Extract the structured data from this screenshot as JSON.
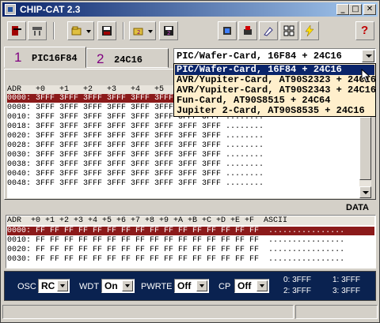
{
  "window": {
    "title": "CHIP-CAT 2.3",
    "minimize": "_",
    "maximize": "□",
    "close": "✕"
  },
  "toolbar": {
    "buttons": [
      "exit-icon",
      "settings-icon",
      "open-icon",
      "save-icon",
      "open2-icon",
      "save2-icon",
      "read-icon",
      "write-icon",
      "erase-icon",
      "verify-icon",
      "auto-icon",
      "help-icon"
    ],
    "help_label": "?"
  },
  "tabs": [
    {
      "num": "1",
      "label": "PIC16F84"
    },
    {
      "num": "2",
      "label": "24C16"
    }
  ],
  "card_select": {
    "value": "PIC/Wafer-Card, 16F84 + 24C16",
    "options": [
      "PIC/Wafer-Card, 16F84 + 24C16",
      "AVR/Yupiter-Card, AT90S2323 + 24C16",
      "AVR/Yupiter-Card, AT90S2343 + 24C16",
      "Fun-Card, AT90S8515 + 24C64",
      "Jupiter 2-Card, AT90S8535 + 24C16"
    ]
  },
  "program_memory": {
    "header": "ADR   +0   +1   +2   +3   +4   +5   +6   +7  ASCII",
    "rows": [
      "0000: 3FFF 3FFF 3FFF 3FFF 3FFF 3FFF 3FFF 3FFF ........",
      "0008: 3FFF 3FFF 3FFF 3FFF 3FFF 3FFF 3FFF 3FFF ........",
      "0010: 3FFF 3FFF 3FFF 3FFF 3FFF 3FFF 3FFF 3FFF ........",
      "0018: 3FFF 3FFF 3FFF 3FFF 3FFF 3FFF 3FFF 3FFF ........",
      "0020: 3FFF 3FFF 3FFF 3FFF 3FFF 3FFF 3FFF 3FFF ........",
      "0028: 3FFF 3FFF 3FFF 3FFF 3FFF 3FFF 3FFF 3FFF ........",
      "0030: 3FFF 3FFF 3FFF 3FFF 3FFF 3FFF 3FFF 3FFF ........",
      "0038: 3FFF 3FFF 3FFF 3FFF 3FFF 3FFF 3FFF 3FFF ........",
      "0040: 3FFF 3FFF 3FFF 3FFF 3FFF 3FFF 3FFF 3FFF ........",
      "0048: 3FFF 3FFF 3FFF 3FFF 3FFF 3FFF 3FFF 3FFF ........"
    ]
  },
  "data_label": "DATA",
  "data_memory": {
    "header": "ADR  +0 +1 +2 +3 +4 +5 +6 +7 +8 +9 +A +B +C +D +E +F  ASCII",
    "rows": [
      "0000: FF FF FF FF FF FF FF FF FF FF FF FF FF FF FF FF  ................",
      "0010: FF FF FF FF FF FF FF FF FF FF FF FF FF FF FF FF  ................",
      "0020: FF FF FF FF FF FF FF FF FF FF FF FF FF FF FF FF  ................",
      "0030: FF FF FF FF FF FF FF FF FF FF FF FF FF FF FF FF  ................"
    ]
  },
  "config": {
    "osc_label": "OSC",
    "osc_value": "RC",
    "wdt_label": "WDT",
    "wdt_value": "On",
    "pwrte_label": "PWRTE",
    "pwrte_value": "Off",
    "cp_label": "CP",
    "cp_value": "Off",
    "words": [
      "0: 3FFF",
      "1: 3FFF",
      "2: 3FFF",
      "3: 3FFF"
    ]
  },
  "colors": {
    "title_start": "#0a246a",
    "title_end": "#a6caf0",
    "highlight_row": "#8b1a1a",
    "config_bg": "#0a2250",
    "dropdown_bg": "#ffefcc"
  }
}
